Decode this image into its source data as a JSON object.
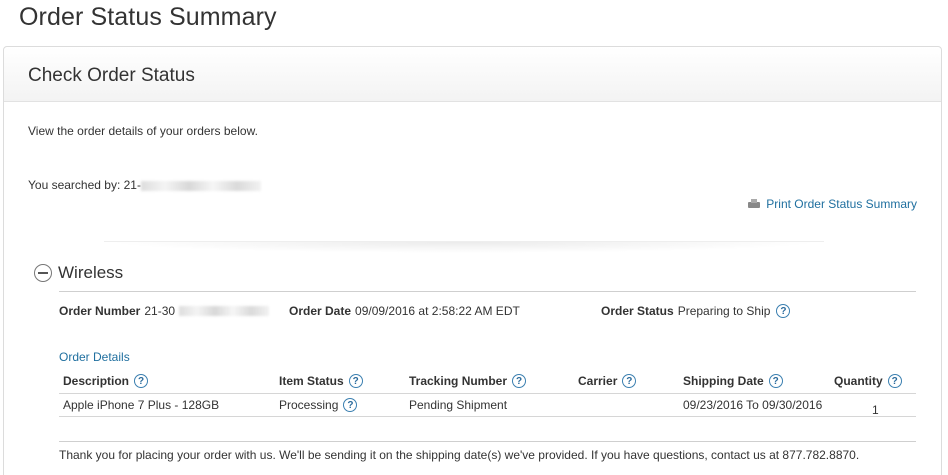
{
  "page": {
    "title": "Order Status Summary"
  },
  "card": {
    "title": "Check Order Status",
    "intro": "View the order details of your orders below.",
    "searched_label": "You searched by: 21-",
    "print_label": "Print Order Status Summary"
  },
  "section": {
    "title": "Wireless",
    "order_number_label": "Order Number",
    "order_number_value": "21-30",
    "order_date_label": "Order Date",
    "order_date_value": "09/09/2016 at 2:58:22 AM EDT",
    "order_status_label": "Order Status",
    "order_status_value": "Preparing to Ship",
    "details_link": "Order Details"
  },
  "table": {
    "headers": {
      "description": "Description",
      "item_status": "Item Status",
      "tracking": "Tracking Number",
      "carrier": "Carrier",
      "shipping_date": "Shipping Date",
      "quantity": "Quantity"
    },
    "rows": [
      {
        "description": "Apple iPhone 7 Plus - 128GB",
        "item_status": "Processing",
        "tracking": "Pending Shipment",
        "carrier": "",
        "shipping_date": "09/23/2016 To 09/30/2016",
        "quantity": "1"
      }
    ]
  },
  "footer": {
    "thanks": "Thank you for placing your order with us. We'll be sending it on the shipping date(s) we've provided. If you have questions, contact us at 877.782.8870."
  },
  "help_glyph": "?",
  "accent_color": "#1f6f9f"
}
